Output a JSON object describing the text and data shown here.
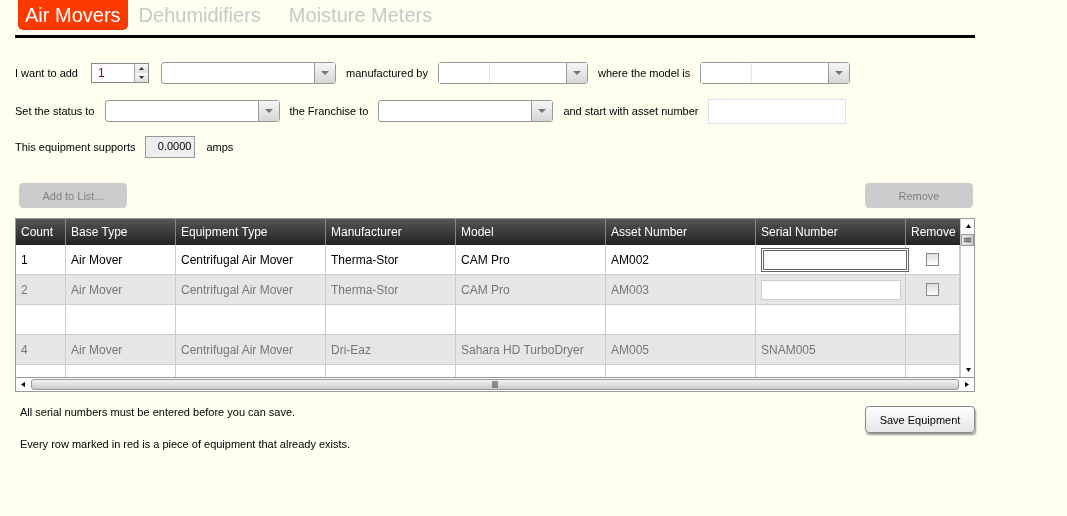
{
  "tabs": [
    {
      "label": "Air Movers",
      "selected": true
    },
    {
      "label": "Dehumidifiers",
      "selected": false
    },
    {
      "label": "Moisture Meters",
      "selected": false
    }
  ],
  "form": {
    "add_label": "I want to add",
    "quantity": "1",
    "manufactured_label": "manufactured by",
    "model_label": "where the model is",
    "status_label": "Set the status to",
    "franchise_label": "the Franchise to",
    "asset_label": "and start with asset number",
    "supports_label": "This equipment supports",
    "amps_value": "0.0000",
    "amps_label": "amps"
  },
  "buttons": {
    "add": {
      "label": "Add to List...",
      "disabled": true
    },
    "remove": {
      "label": "Remove",
      "disabled": true
    },
    "save": {
      "label": "Save Equipment",
      "disabled": false
    }
  },
  "table": {
    "columns": [
      "Count",
      "Base Type",
      "Equipment Type",
      "Manufacturer",
      "Model",
      "Asset Number",
      "Serial Number",
      "Remove"
    ],
    "rows": [
      {
        "kind": "item",
        "dimmed": false,
        "cells": [
          "1",
          "Air Mover",
          "Centrifugal Air Mover",
          "Therma-Stor",
          "CAM Pro",
          "AM002"
        ],
        "serial_field": true,
        "remove_checkbox": {
          "checked": false
        }
      },
      {
        "kind": "item",
        "dimmed": true,
        "cells": [
          "2",
          "Air Mover",
          "Centrifugal Air Mover",
          "Therma-Stor",
          "CAM Pro",
          "AM003"
        ],
        "serial_field": true,
        "remove_checkbox": {
          "checked": false
        }
      },
      {
        "kind": "blank"
      },
      {
        "kind": "item",
        "dimmed": true,
        "cells": [
          "4",
          "Air Mover",
          "Centrifugal Air Mover",
          "Dri-Eaz",
          "Sahara HD TurboDryer",
          "AM005"
        ],
        "serial": "SNAM005"
      },
      {
        "kind": "blank"
      }
    ]
  },
  "notes": [
    "All serial numbers must be entered before you can save.",
    "Every row marked in red is a piece of equipment that already exists."
  ]
}
